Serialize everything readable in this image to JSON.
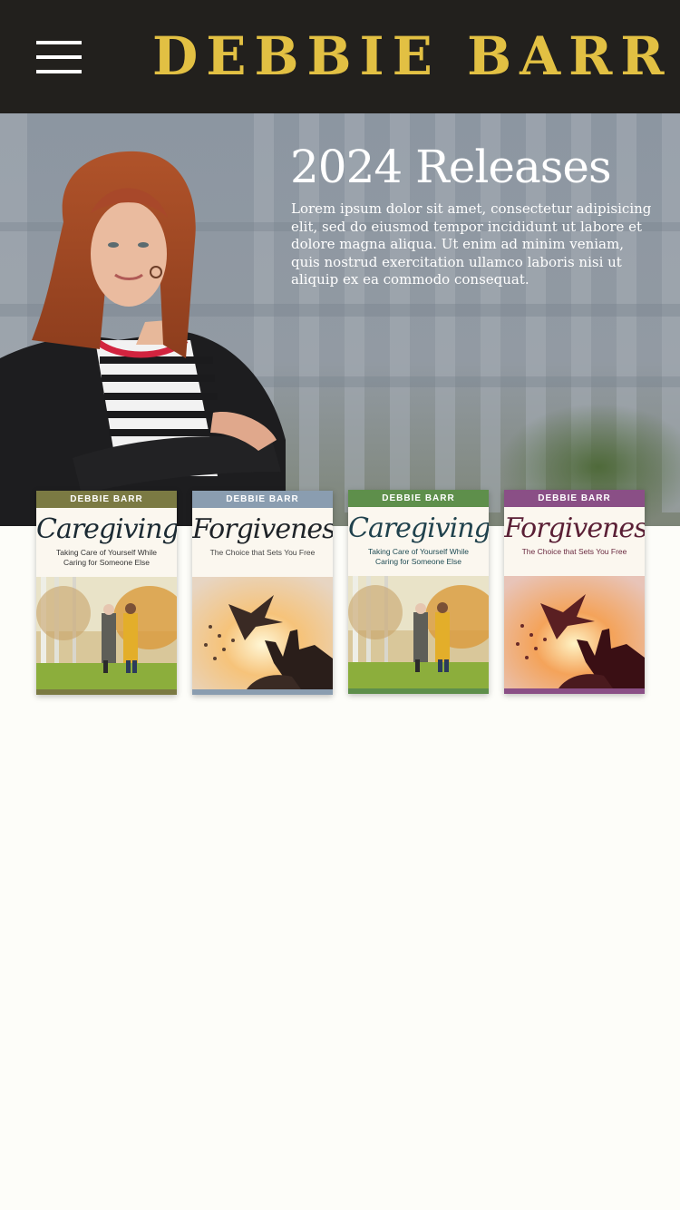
{
  "header": {
    "menu_icon": "hamburger-menu-icon",
    "brand": "DEBBIE BARR",
    "background": "#22201d",
    "brand_color": "#e2c043"
  },
  "hero": {
    "title": "2024 Releases",
    "text": "Lorem ipsum dolor sit amet, consectetur adipisicing elit, sed do eiusmod tempor incididunt ut labore et dolore magna aliqua. Ut enim ad minim veniam, quis nostrud exercitation ullamco laboris nisi ut aliquip ex ea commodo consequat."
  },
  "books": [
    {
      "author": "DEBBIE BARR",
      "title": "Caregiving",
      "subtitle": "Taking Care of Yourself While Caring for Someone Else",
      "band_color": "#7b7a43",
      "title_color": "#1b2a33",
      "subtitle_color": "#333333"
    },
    {
      "author": "DEBBIE BARR",
      "title": "Forgiveness",
      "subtitle": "The Choice that Sets You Free",
      "band_color": "#8a9db0",
      "title_color": "#1e2328",
      "subtitle_color": "#444444"
    },
    {
      "author": "DEBBIE BARR",
      "title": "Caregiving",
      "subtitle": "Taking Care of Yourself While Caring for Someone Else",
      "band_color": "#5e8f4b",
      "title_color": "#20424d",
      "subtitle_color": "#1f4c55"
    },
    {
      "author": "DEBBIE BARR",
      "title": "Forgiveness",
      "subtitle": "The Choice that Sets You Free",
      "band_color": "#8a4f86",
      "title_color": "#5a1f35",
      "subtitle_color": "#6a2a40"
    }
  ]
}
